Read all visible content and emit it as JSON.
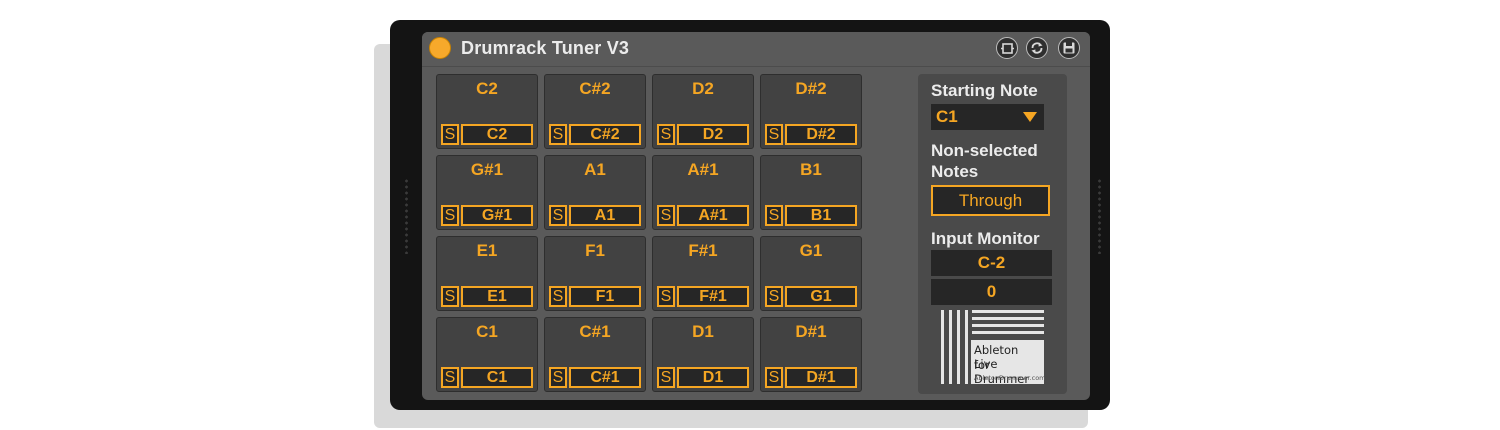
{
  "device": {
    "title": "Drumrack Tuner V3",
    "accent_color": "#f5a623",
    "buttons": [
      {
        "name": "hotswap-icon"
      },
      {
        "name": "refresh-icon"
      },
      {
        "name": "save-icon"
      }
    ]
  },
  "pads": [
    {
      "label": "C2",
      "solo": "S",
      "note": "C2"
    },
    {
      "label": "C#2",
      "solo": "S",
      "note": "C#2"
    },
    {
      "label": "D2",
      "solo": "S",
      "note": "D2"
    },
    {
      "label": "D#2",
      "solo": "S",
      "note": "D#2"
    },
    {
      "label": "G#1",
      "solo": "S",
      "note": "G#1"
    },
    {
      "label": "A1",
      "solo": "S",
      "note": "A1"
    },
    {
      "label": "A#1",
      "solo": "S",
      "note": "A#1"
    },
    {
      "label": "B1",
      "solo": "S",
      "note": "B1"
    },
    {
      "label": "E1",
      "solo": "S",
      "note": "E1"
    },
    {
      "label": "F1",
      "solo": "S",
      "note": "F1"
    },
    {
      "label": "F#1",
      "solo": "S",
      "note": "F#1"
    },
    {
      "label": "G1",
      "solo": "S",
      "note": "G1"
    },
    {
      "label": "C1",
      "solo": "S",
      "note": "C1"
    },
    {
      "label": "C#1",
      "solo": "S",
      "note": "C#1"
    },
    {
      "label": "D1",
      "solo": "S",
      "note": "D1"
    },
    {
      "label": "D#1",
      "solo": "S",
      "note": "D#1"
    }
  ],
  "side": {
    "starting_note_label": "Starting Note",
    "starting_note_value": "C1",
    "non_selected_label_1": "Non-selected",
    "non_selected_label_2": "Notes",
    "non_selected_value": "Through",
    "input_monitor_label": "Input Monitor",
    "input_monitor_note": "C-2",
    "input_monitor_velocity": "0"
  },
  "logo": {
    "line1": "Ableton Live",
    "line2": "for Drummer",
    "url": "AbletonDrummer.com"
  }
}
